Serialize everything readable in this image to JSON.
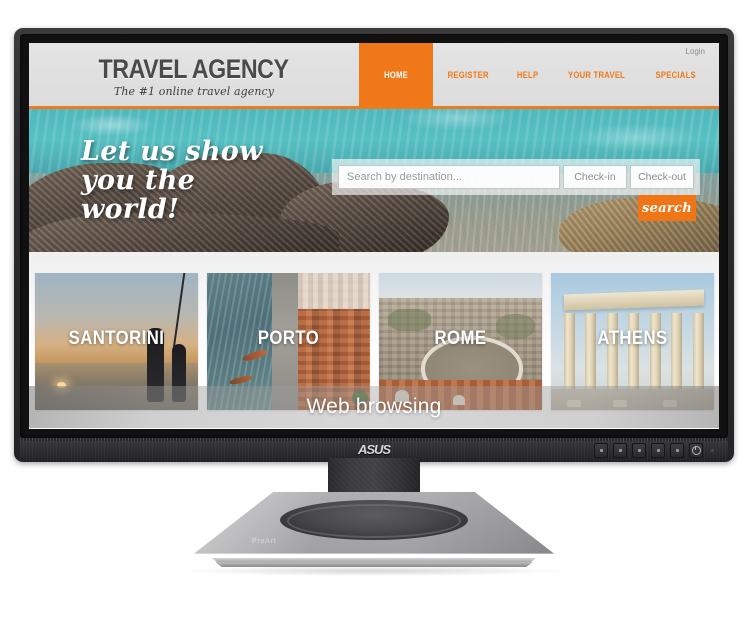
{
  "monitor": {
    "brand": "ASUS",
    "stand_brand": "ProArt",
    "osd_buttons": [
      "menu-button",
      "up-button",
      "down-button",
      "input-button",
      "close-button",
      "power-button"
    ]
  },
  "overlay": {
    "caption": "Web browsing"
  },
  "site": {
    "brand": {
      "title": "TRAVEL AGENCY",
      "tagline": "The #1 online travel agency"
    },
    "account": {
      "login_label": "Login"
    },
    "nav": [
      {
        "label": "HOME",
        "active": true
      },
      {
        "label": "REGISTER",
        "active": false
      },
      {
        "label": "HELP",
        "active": false
      },
      {
        "label": "YOUR TRAVEL",
        "active": false
      },
      {
        "label": "SPECIALS",
        "active": false
      }
    ],
    "hero": {
      "headline_line1": "Let us show",
      "headline_line2": "you the world!",
      "search": {
        "destination_placeholder": "Search by destination...",
        "destination_value": "",
        "checkin_label": "Check-in",
        "checkout_label": "Check-out",
        "submit_label": "search"
      }
    },
    "destinations": [
      {
        "name": "SANTORINI"
      },
      {
        "name": "PORTO"
      },
      {
        "name": "ROME"
      },
      {
        "name": "ATHENS"
      }
    ],
    "colors": {
      "accent_orange": "#ef7517",
      "header_gray": "#e0e0e0",
      "brand_text": "#4a4a4a"
    }
  }
}
